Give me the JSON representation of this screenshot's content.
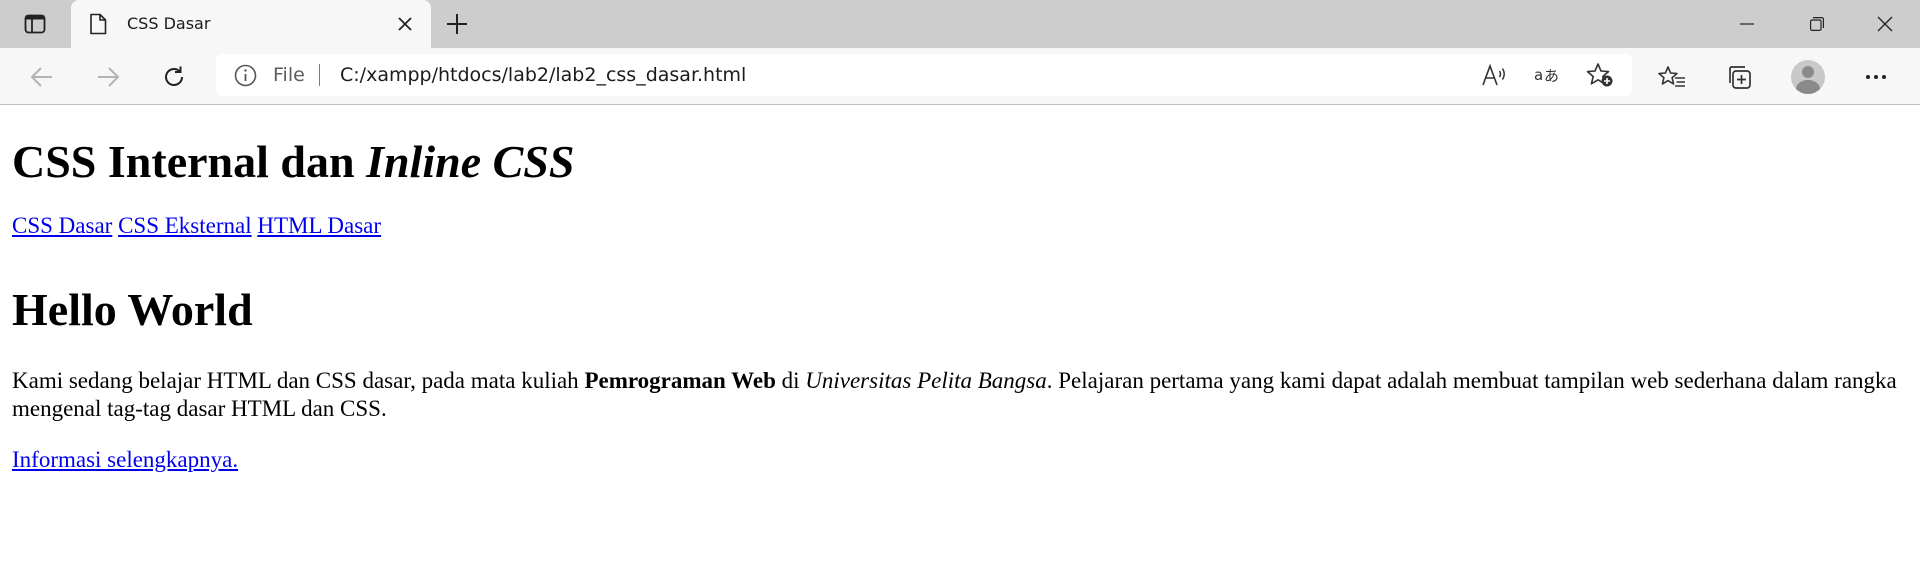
{
  "browser": {
    "tab": {
      "title": "CSS Dasar"
    },
    "address": {
      "scheme": "File",
      "url": "C:/xampp/htdocs/lab2/lab2_css_dasar.html"
    },
    "icons": {
      "tab_actions": "tab-actions-icon",
      "page": "page-icon",
      "close": "close-icon",
      "new_tab": "plus-icon",
      "minimize": "minimize-icon",
      "restore": "restore-icon",
      "window_close": "close-icon",
      "back": "back-arrow-icon",
      "forward": "forward-arrow-icon",
      "refresh": "refresh-icon",
      "info": "info-icon",
      "read_aloud": "read-aloud-icon",
      "translate": "translate-icon",
      "add_favorite": "add-favorite-icon",
      "favorites": "favorites-icon",
      "collections": "collections-icon",
      "profile": "profile-avatar",
      "menu": "more-options-icon"
    }
  },
  "page": {
    "heading1": {
      "normal": "CSS Internal dan ",
      "italic": "Inline CSS"
    },
    "nav": [
      "CSS Dasar",
      "CSS Eksternal",
      "HTML Dasar"
    ],
    "heading2": "Hello World",
    "paragraph": {
      "part1": "Kami sedang belajar HTML dan CSS dasar, pada mata kuliah ",
      "bold": "Pemrograman Web",
      "part2": " di ",
      "italic": "Universitas Pelita Bangsa",
      "part3": ". Pelajaran pertama yang kami dapat adalah membuat tampilan web sederhana dalam rangka mengenal tag-tag dasar HTML dan CSS."
    },
    "more_link": "Informasi selengkapnya."
  },
  "colors": {
    "tabstrip": "#cdcdcd",
    "toolbar": "#f7f7f7",
    "link": "#0000ee"
  }
}
